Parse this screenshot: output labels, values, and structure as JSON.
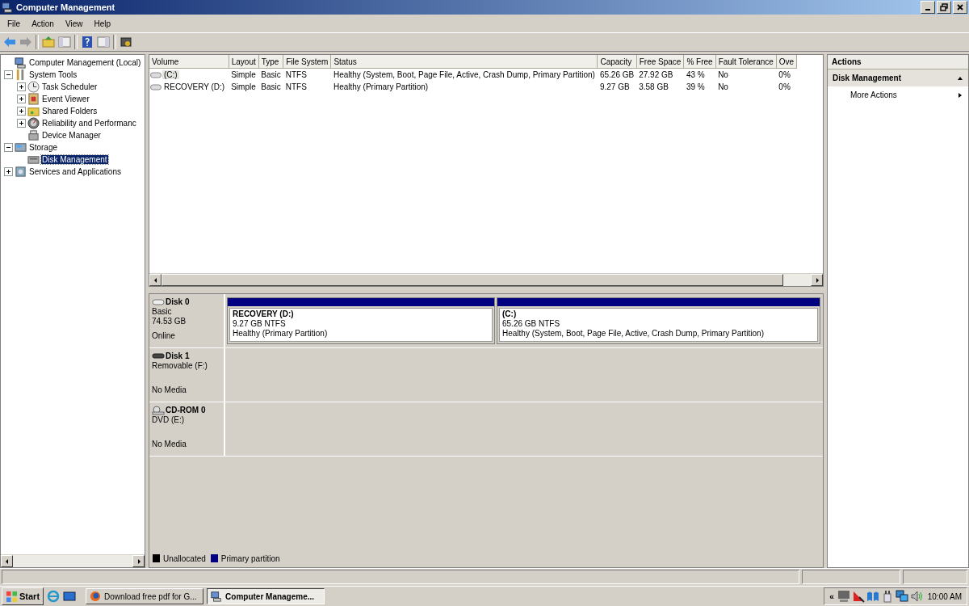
{
  "window": {
    "title": "Computer Management"
  },
  "menu": [
    "File",
    "Action",
    "View",
    "Help"
  ],
  "tree": [
    {
      "label": "Computer Management (Local)",
      "children": [
        {
          "label": "System Tools",
          "expanded": true,
          "children": [
            {
              "label": "Task Scheduler",
              "expanded": false,
              "selected": false
            },
            {
              "label": "Event Viewer",
              "expanded": false,
              "selected": false
            },
            {
              "label": "Shared Folders",
              "expanded": false,
              "selected": false
            },
            {
              "label": "Reliability and Performanc",
              "expanded": false,
              "selected": false
            },
            {
              "label": "Device Manager",
              "selected": false
            }
          ],
          "selected": false
        },
        {
          "label": "Storage",
          "expanded": true,
          "selected": false,
          "children": [
            {
              "label": "Disk Management",
              "selected": true
            }
          ]
        },
        {
          "label": "Services and Applications",
          "expanded": false,
          "selected": false
        }
      ],
      "selected": false
    }
  ],
  "volume_table": {
    "columns": [
      "Volume",
      "Layout",
      "Type",
      "File System",
      "Status",
      "Capacity",
      "Free Space",
      "% Free",
      "Fault Tolerance",
      "Ove"
    ],
    "rows": [
      {
        "selected": true,
        "cells": [
          "(C:)",
          "Simple",
          "Basic",
          "NTFS",
          "Healthy (System, Boot, Page File, Active, Crash Dump, Primary Partition)",
          "65.26 GB",
          "27.92 GB",
          "43 %",
          "No",
          "0%"
        ]
      },
      {
        "selected": false,
        "cells": [
          "RECOVERY (D:)",
          "Simple",
          "Basic",
          "NTFS",
          "Healthy (Primary Partition)",
          "9.27 GB",
          "3.58 GB",
          "39 %",
          "No",
          "0%"
        ]
      }
    ]
  },
  "disks": [
    {
      "kind": "hdd",
      "name": "Disk 0",
      "details": [
        "Basic",
        "74.53 GB"
      ],
      "state": "Online",
      "partitions": [
        {
          "title": "RECOVERY  (D:)",
          "size": "9.27 GB NTFS",
          "status": "Healthy (Primary Partition)",
          "color": "#000080"
        },
        {
          "title": "(C:)",
          "size": "65.26 GB NTFS",
          "status": "Healthy (System, Boot, Page File, Active, Crash Dump, Primary Partition)",
          "color": "#000080"
        }
      ]
    },
    {
      "kind": "removable",
      "name": "Disk 1",
      "details": [
        "Removable (F:)"
      ],
      "state": "No Media"
    },
    {
      "kind": "cdrom",
      "name": "CD-ROM 0",
      "details": [
        "DVD (E:)"
      ],
      "state": "No Media"
    }
  ],
  "legend": [
    {
      "label": "Unallocated",
      "color": "#000000"
    },
    {
      "label": "Primary partition",
      "color": "#000080"
    }
  ],
  "actions": {
    "header": "Actions",
    "sections": [
      {
        "title": "Disk Management",
        "expanded": true,
        "items": [
          "More Actions"
        ]
      }
    ]
  },
  "taskbar": {
    "start": "Start",
    "tasks": [
      {
        "label": "Download free pdf for G...",
        "kind": "browser",
        "selected": false
      },
      {
        "label": "Computer Manageme...",
        "kind": "console",
        "selected": true
      }
    ],
    "tray_toggle": "«",
    "clock": "10:00 AM"
  }
}
